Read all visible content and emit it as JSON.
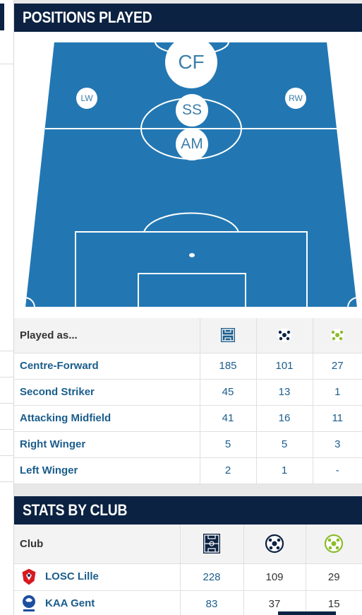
{
  "positions_section": {
    "title": "POSITIONS PLAYED",
    "pitch_labels": {
      "cf": "CF",
      "ss": "SS",
      "am": "AM",
      "lw": "LW",
      "rw": "RW"
    },
    "table": {
      "header": "Played as...",
      "header_icons": [
        "pitch-icon",
        "ball-icon",
        "assist-ball-icon"
      ],
      "rows": [
        {
          "position": "Centre-Forward",
          "apps": "185",
          "goals": "101",
          "assists": "27"
        },
        {
          "position": "Second Striker",
          "apps": "45",
          "goals": "13",
          "assists": "1"
        },
        {
          "position": "Attacking Midfield",
          "apps": "41",
          "goals": "16",
          "assists": "11"
        },
        {
          "position": "Right Winger",
          "apps": "5",
          "goals": "5",
          "assists": "3"
        },
        {
          "position": "Left Winger",
          "apps": "2",
          "goals": "1",
          "assists": "-"
        }
      ]
    }
  },
  "club_section": {
    "title": "STATS BY CLUB",
    "table": {
      "header": "Club",
      "header_icons": [
        "pitch-icon",
        "ball-icon",
        "assist-ball-icon"
      ],
      "rows": [
        {
          "club": "LOSC Lille",
          "logo": "losc-lille-logo",
          "apps": "228",
          "goals": "109",
          "assists": "29"
        },
        {
          "club": "KAA Gent",
          "logo": "kaa-gent-logo",
          "apps": "83",
          "goals": "37",
          "assists": "15"
        }
      ]
    }
  },
  "colors": {
    "header_bg": "#0b2242",
    "pitch_blue": "#2277b3",
    "link_blue": "#1b5d8c",
    "assist_green": "#8bbd2a"
  }
}
